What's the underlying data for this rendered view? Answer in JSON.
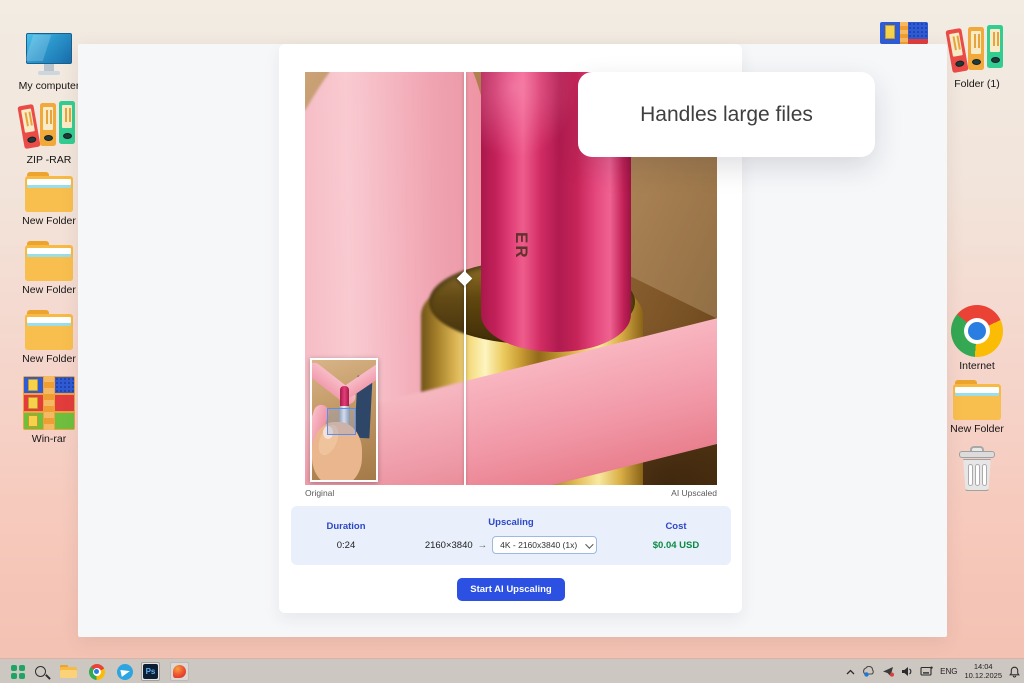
{
  "desktop": {
    "left_icons": [
      {
        "label": "My computer"
      },
      {
        "label": "ZIP -RAR"
      },
      {
        "label": "New Folder"
      },
      {
        "label": "New Folder"
      },
      {
        "label": "New Folder"
      },
      {
        "label": "Win-rar"
      }
    ],
    "right_icons": [
      {
        "label": "Folder (1)"
      },
      {
        "label": "Internet"
      },
      {
        "label": "New Folder"
      }
    ]
  },
  "app": {
    "tooltip_text": "Handles large files",
    "image_brand_text": "ER",
    "compare": {
      "left_label": "Original",
      "right_label": "AI Upscaled"
    },
    "panel": {
      "duration_label": "Duration",
      "duration_value": "0:24",
      "upscaling_label": "Upscaling",
      "source_resolution": "2160×3840",
      "arrow": "→",
      "selected_option": "4K - 2160x3840 (1x)",
      "cost_label": "Cost",
      "cost_value": "$0.04 USD"
    },
    "start_button_label": "Start AI Upscaling"
  },
  "taskbar": {
    "tray": {
      "language": "ENG",
      "time": "14:04",
      "date": "10.12.2025"
    }
  },
  "colors": {
    "accent_blue": "#2b50e2",
    "panel_bg": "#e9f0fb",
    "label_blue": "#2d47c8",
    "cost_green": "#0a8a43"
  }
}
